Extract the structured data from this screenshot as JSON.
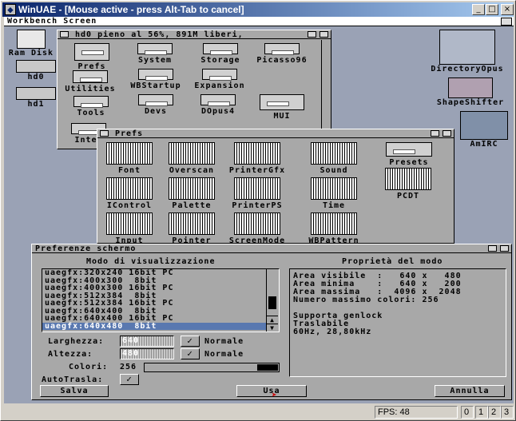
{
  "host": {
    "title": "WinUAE - [Mouse active - press Alt-Tab to cancel]",
    "min": "_",
    "max": "□",
    "close": "×",
    "status": {
      "fps": "FPS: 48",
      "d0": "0",
      "d1": "1",
      "d2": "2",
      "d3": "3"
    }
  },
  "workbench": {
    "title": "Workbench Screen"
  },
  "desktop": {
    "ram": "Ram Disk",
    "hd0": "hd0",
    "hd1": "hd1",
    "dopus": "DirectoryOpus",
    "shape": "ShapeShifter",
    "amirc": "AmIRC"
  },
  "hd0win": {
    "title": "hd0  pieno al 56%, 891M liberi,",
    "icons": [
      "Prefs",
      "System",
      "Storage",
      "Picasso96",
      "Utilities",
      "WBStartup",
      "Expansion",
      "Tools",
      "Devs",
      "DOpus4",
      "MUI",
      "Inter"
    ]
  },
  "prefswin": {
    "title": "Prefs",
    "icons": [
      "Font",
      "Overscan",
      "PrinterGfx",
      "Sound",
      "Presets",
      "IControl",
      "Palette",
      "PrinterPS",
      "Time",
      "PCDT",
      "Input",
      "Pointer",
      "ScreenMode",
      "WBPattern"
    ]
  },
  "screenmode": {
    "title": "Preferenze schermo",
    "mode_header": "Modo di visualizzazione",
    "props_header": "Proprietà del modo",
    "modes": [
      "uaegfx:320x240 16bit PC",
      "uaegfx:400x300  8bit",
      "uaegfx:400x300 16bit PC",
      "uaegfx:512x384  8bit",
      "uaegfx:512x384 16bit PC",
      "uaegfx:640x400  8bit",
      "uaegfx:640x400 16bit PC",
      "uaegfx:640x480  8bit"
    ],
    "selected_index": 7,
    "props": [
      "Area visibile  :   640 x   480",
      "Area minima    :   640 x   200",
      "Area massima   :  4096 x  2048",
      "Numero massimo colori: 256",
      "",
      "Supporta genlock",
      "Traslabile",
      "60Hz, 28,80kHz"
    ],
    "width_label": "Larghezza:",
    "width_value": "640",
    "height_label": "Altezza:",
    "height_value": "480",
    "default_label": "Normale",
    "colors_label": "Colori:",
    "colors_value": "256",
    "autoscroll_label": "AutoTrasla:",
    "check": "✓",
    "save": "Salva",
    "use": "Usa",
    "cancel": "Annulla"
  }
}
